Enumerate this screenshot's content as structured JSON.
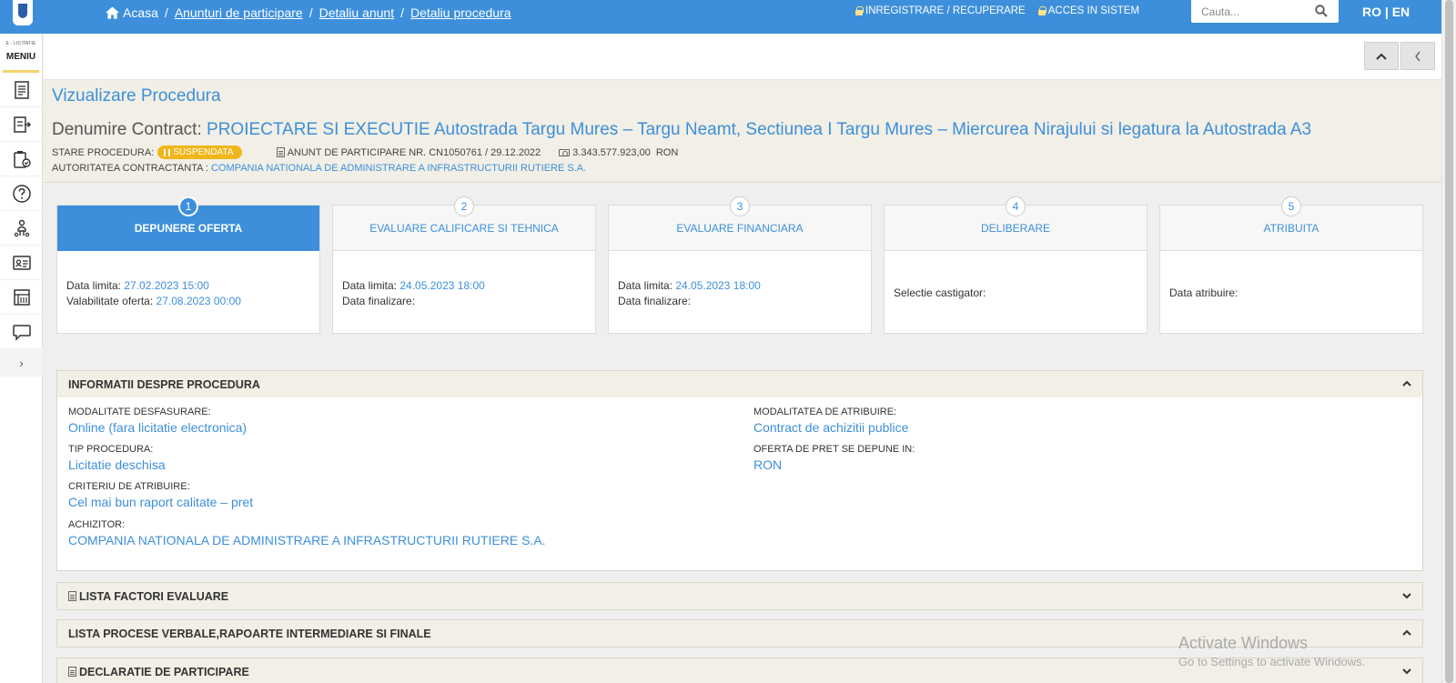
{
  "breadcrumb": {
    "home": "Acasa",
    "items": [
      "Anunturi de participare",
      "Detaliu anunt",
      "Detaliu procedura"
    ]
  },
  "top_links": {
    "register": "INREGISTRARE / RECUPERARE",
    "login": "ACCES IN SISTEM"
  },
  "search": {
    "placeholder": "Cauta..."
  },
  "lang": "RO | EN",
  "sidebar": {
    "brand": "E - LICITATIE",
    "menu": "MENIU",
    "icons": [
      "document-list-icon",
      "export-list-icon",
      "clipboard-check-icon",
      "help-icon",
      "user-tree-icon",
      "id-card-icon",
      "catalog-icon",
      "chat-icon"
    ]
  },
  "header": {
    "title": "Vizualizare Procedura",
    "contract_label": "Denumire Contract:",
    "contract_value": "PROIECTARE SI EXECUTIE Autostrada Targu Mures – Targu Neamt, Sectiunea I Targu Mures – Miercurea Nirajului si legatura la Autostrada A3",
    "status_label": "STARE PROCEDURA:",
    "status_value": "SUSPENDATA",
    "notice": "ANUNT DE PARTICIPARE NR. CN1050761 / 29.12.2022",
    "value": "3.343.577.923,00",
    "currency": "RON",
    "authority_label": "AUTORITATEA CONTRACTANTA :",
    "authority_value": "COMPANIA NATIONALA DE ADMINISTRARE A INFRASTRUCTURII RUTIERE S.A."
  },
  "steps": [
    {
      "num": "1",
      "title": "DEPUNERE OFERTA",
      "l1": "Data limita:",
      "v1": "27.02.2023 15:00",
      "l2": "Valabilitate oferta:",
      "v2": "27.08.2023 00:00"
    },
    {
      "num": "2",
      "title": "EVALUARE CALIFICARE SI TEHNICA",
      "l1": "Data limita:",
      "v1": "24.05.2023 18:00",
      "l2": "Data finalizare:",
      "v2": ""
    },
    {
      "num": "3",
      "title": "EVALUARE FINANCIARA",
      "l1": "Data limita:",
      "v1": "24.05.2023 18:00",
      "l2": "Data finalizare:",
      "v2": ""
    },
    {
      "num": "4",
      "title": "DELIBERARE",
      "l1": "Selectie castigator:"
    },
    {
      "num": "5",
      "title": "ATRIBUITA",
      "l1": "Data atribuire:"
    }
  ],
  "info": {
    "title": "INFORMATII DESPRE PROCEDURA",
    "modalitate_label": "MODALITATE DESFASURARE:",
    "modalitate_value": "Online (fara licitatie electronica)",
    "tip_label": "TIP PROCEDURA:",
    "tip_value": "Licitatie deschisa",
    "criteriu_label": "CRITERIU DE ATRIBUIRE:",
    "criteriu_value": "Cel mai bun raport calitate – pret",
    "achizitor_label": "ACHIZITOR:",
    "achizitor_value": "COMPANIA NATIONALA DE ADMINISTRARE A INFRASTRUCTURII RUTIERE S.A.",
    "modalitatea_atribuire_label": "MODALITATEA DE ATRIBUIRE:",
    "modalitatea_atribuire_value": "Contract de achizitii publice",
    "oferta_label": "OFERTA DE PRET SE DEPUNE IN:",
    "oferta_value": "RON"
  },
  "sections": {
    "factori": "LISTA FACTORI EVALUARE",
    "procese": "LISTA PROCESE VERBALE,RAPOARTE INTERMEDIARE SI FINALE",
    "declaratie": "DECLARATIE DE PARTICIPARE"
  },
  "watermark": {
    "line1": "Activate Windows",
    "line2": "Go to Settings to activate Windows."
  }
}
